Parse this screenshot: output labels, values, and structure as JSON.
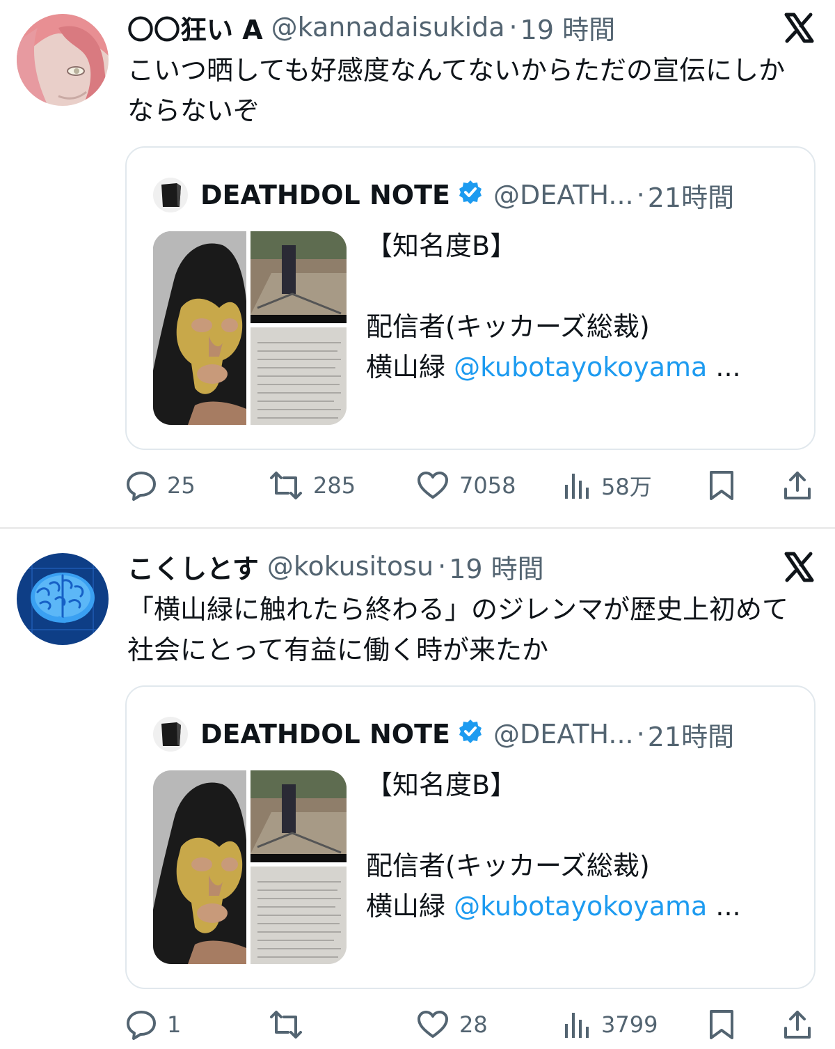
{
  "tweets": [
    {
      "name": "〇〇狂い A",
      "handle": "@kannadaisukida",
      "time": "19 時間",
      "text": "こいつ晒しても好感度なんてないからただの宣伝にしかならないぞ",
      "quote": {
        "name": "DEATHDOL NOTE",
        "handle": "@DEATH...",
        "time": "21時間",
        "lines": [
          "【知名度B】",
          "",
          "配信者(キッカーズ総裁)"
        ],
        "last_line_prefix": "横山緑 ",
        "mention": "@kubotayokoyama",
        "ellipsis": " ..."
      },
      "stats": {
        "replies": "25",
        "reposts": "285",
        "likes": "7058",
        "views": "58万"
      }
    },
    {
      "name": "こくしとす",
      "handle": "@kokusitosu",
      "time": "19 時間",
      "text": "「横山緑に触れたら終わる」のジレンマが歴史上初めて社会にとって有益に働く時が来たか",
      "quote": {
        "name": "DEATHDOL NOTE",
        "handle": "@DEATH...",
        "time": "21時間",
        "lines": [
          "【知名度B】",
          "",
          "配信者(キッカーズ総裁)"
        ],
        "last_line_prefix": "横山緑 ",
        "mention": "@kubotayokoyama",
        "ellipsis": " ..."
      },
      "stats": {
        "replies": "1",
        "reposts": "",
        "likes": "28",
        "views": "3799"
      }
    }
  ],
  "colors": {
    "text": "#0f1419",
    "secondary": "#536471",
    "link": "#1d9bf0",
    "border": "#e1e8ed"
  },
  "icons": [
    "x-logo-icon",
    "reply-icon",
    "repost-icon",
    "like-icon",
    "views-icon",
    "bookmark-icon",
    "share-icon",
    "verified-badge-icon"
  ]
}
